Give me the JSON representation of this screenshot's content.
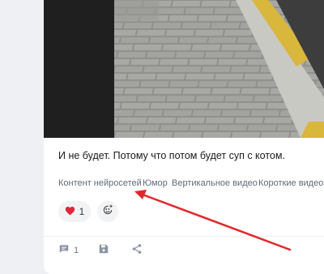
{
  "post": {
    "caption": "И не будет. Потому что потом будет суп с котом.",
    "tags": [
      "Контент нейросетей",
      "Юмор",
      "Вертикальное видео",
      "Короткие видео"
    ],
    "like_count": "1",
    "comment_count": "1"
  },
  "icons": {
    "like": "heart-icon",
    "react": "emoji-add-icon",
    "comment": "comment-icon",
    "save": "save-icon",
    "share": "share-icon"
  },
  "colors": {
    "heart": "#e0263a",
    "annotation_arrow": "#e3262a",
    "tag_text": "#5f6b7a"
  }
}
